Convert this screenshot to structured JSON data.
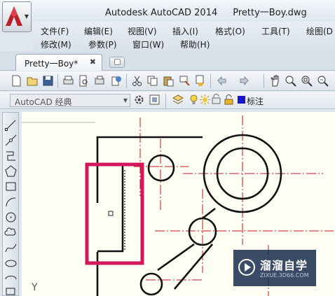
{
  "title": {
    "app": "Autodesk AutoCAD 2014",
    "document": "Pretty一Boy.dwg"
  },
  "menubar": {
    "row1": [
      "文件(F)",
      "编辑(E)",
      "视图(V)",
      "插入(I)",
      "格式(O)",
      "工具(T)",
      "绘图(D"
    ],
    "row2": [
      "修改(M)",
      "参数(P)",
      "窗口(W)",
      "帮助(H)"
    ]
  },
  "tabs": {
    "active": "Pretty一Boy*",
    "close_glyph": "✖"
  },
  "workspace": {
    "selected": "AutoCAD 经典",
    "layer_label": "标注"
  },
  "canvas": {
    "axis_label": "Y"
  },
  "watermark": {
    "brand": "溜溜自学",
    "url": "ZIXUE.3D66.COM"
  },
  "colors": {
    "accent_red": "#b8202a",
    "highlight": "#d0185a",
    "centerline": "#c6151f",
    "canvas_bg": "#fefef2"
  },
  "icons": {
    "toolbar": [
      "new-icon",
      "open-icon",
      "save-icon",
      "print-icon",
      "preview-icon",
      "publish-icon",
      "plot-3d-icon",
      "cut-icon",
      "copy-icon",
      "paste-icon",
      "match-properties-icon",
      "brush-icon",
      "undo-icon",
      "redo-icon",
      "pan-icon",
      "zoom-realtime-icon",
      "zoom-window-icon",
      "zoom-previous-icon"
    ],
    "draw": [
      "line-icon",
      "construction-line-icon",
      "polyline-icon",
      "polygon-icon",
      "rectangle-icon",
      "arc-icon",
      "circle-icon",
      "revision-cloud-icon",
      "spline-icon",
      "ellipse-icon",
      "ellipse-arc-icon",
      "insert-block-icon"
    ]
  }
}
